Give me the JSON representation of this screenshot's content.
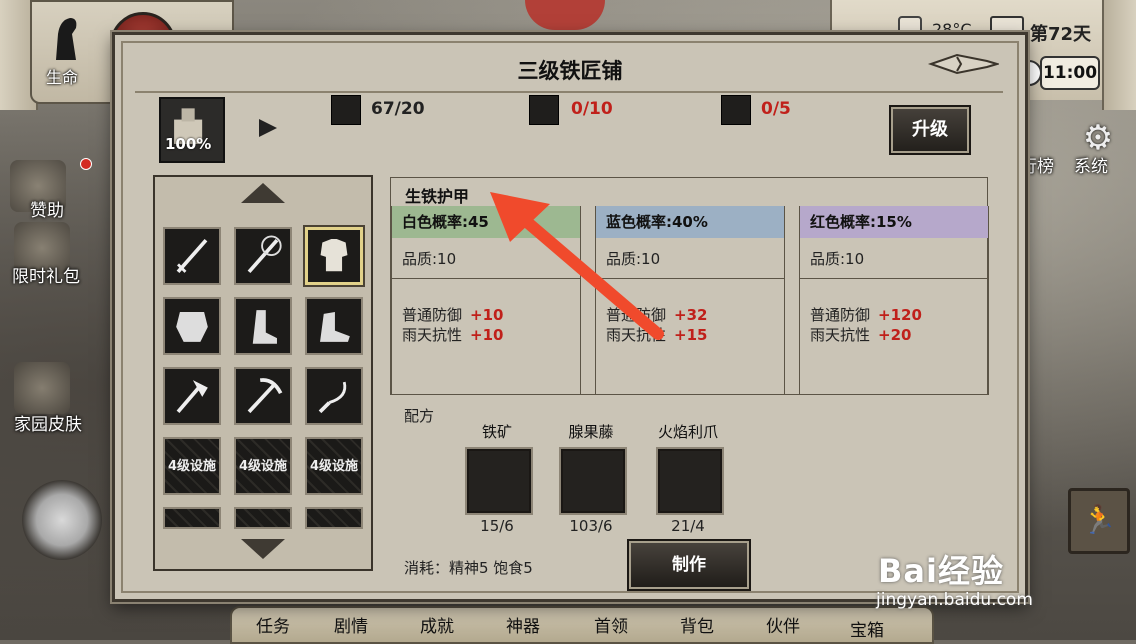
{
  "hud": {
    "hp_label": "生命",
    "temperature": "28°C",
    "day": "第72天",
    "time": "11:00",
    "side_left": [
      "赞助",
      "限时礼包",
      "家园皮肤"
    ],
    "side_right": [
      "行榜",
      "系统"
    ],
    "bottom_tabs": [
      "任务",
      "剧情",
      "成就",
      "神器",
      "首领",
      "背包",
      "伙伴",
      "宝箱"
    ]
  },
  "modal": {
    "title": "三级铁匠铺",
    "building_progress": "100%",
    "resources": [
      {
        "icon": "iron-plate-icon",
        "value": "67/20",
        "color": "#222222"
      },
      {
        "icon": "ore-crystal-icon",
        "value": "0/10",
        "color": "#c0201a"
      },
      {
        "icon": "book-stack-icon",
        "value": "0/5",
        "color": "#c0201a"
      }
    ],
    "upgrade_label": "升级",
    "item_name": "生铁护甲",
    "grid_slots": [
      {
        "icon": "sword-icon",
        "label": ""
      },
      {
        "icon": "flaming-sword-icon",
        "label": ""
      },
      {
        "icon": "chest-armor-icon",
        "label": "",
        "selected": true
      },
      {
        "icon": "ornate-armor-icon",
        "label": ""
      },
      {
        "icon": "boots-icon",
        "label": ""
      },
      {
        "icon": "winged-boots-icon",
        "label": ""
      },
      {
        "icon": "axe-icon",
        "label": ""
      },
      {
        "icon": "pickaxe-icon",
        "label": ""
      },
      {
        "icon": "sickle-icon",
        "label": ""
      },
      {
        "icon": "locked-icon",
        "label": "4级设施"
      },
      {
        "icon": "locked-icon",
        "label": "4级设施"
      },
      {
        "icon": "locked-icon",
        "label": "4级设施"
      }
    ],
    "tiers": [
      {
        "header": "白色概率:45",
        "color": "#9db891",
        "quality": "品质:10",
        "defense_label": "普通防御",
        "defense": "+10",
        "rain_label": "雨天抗性",
        "rain": "+10"
      },
      {
        "header": "蓝色概率:40%",
        "color": "#9cb0c4",
        "quality": "品质:10",
        "defense_label": "普通防御",
        "defense": "+32",
        "rain_label": "雨天抗性",
        "rain": "+15"
      },
      {
        "header": "红色概率:15%",
        "color": "#b6a8cb",
        "quality": "品质:10",
        "defense_label": "普通防御",
        "defense": "+120",
        "rain_label": "雨天抗性",
        "rain": "+20"
      }
    ],
    "recipe_label": "配方",
    "materials": [
      {
        "name": "铁矿",
        "icon": "iron-ore-icon",
        "count": "15/6"
      },
      {
        "name": "腺果藤",
        "icon": "vine-icon",
        "count": "103/6"
      },
      {
        "name": "火焰利爪",
        "icon": "flame-claw-icon",
        "count": "21/4"
      }
    ],
    "consume_text": "消耗：精神5   饱食5",
    "make_label": "制作"
  },
  "watermark": {
    "brand": "Bai经验",
    "url": "jingyan.baidu.com"
  },
  "colors": {
    "annotation_arrow": "#f04a2c",
    "modal_bg": "#cac4b6",
    "negative_value": "#c0201a"
  }
}
